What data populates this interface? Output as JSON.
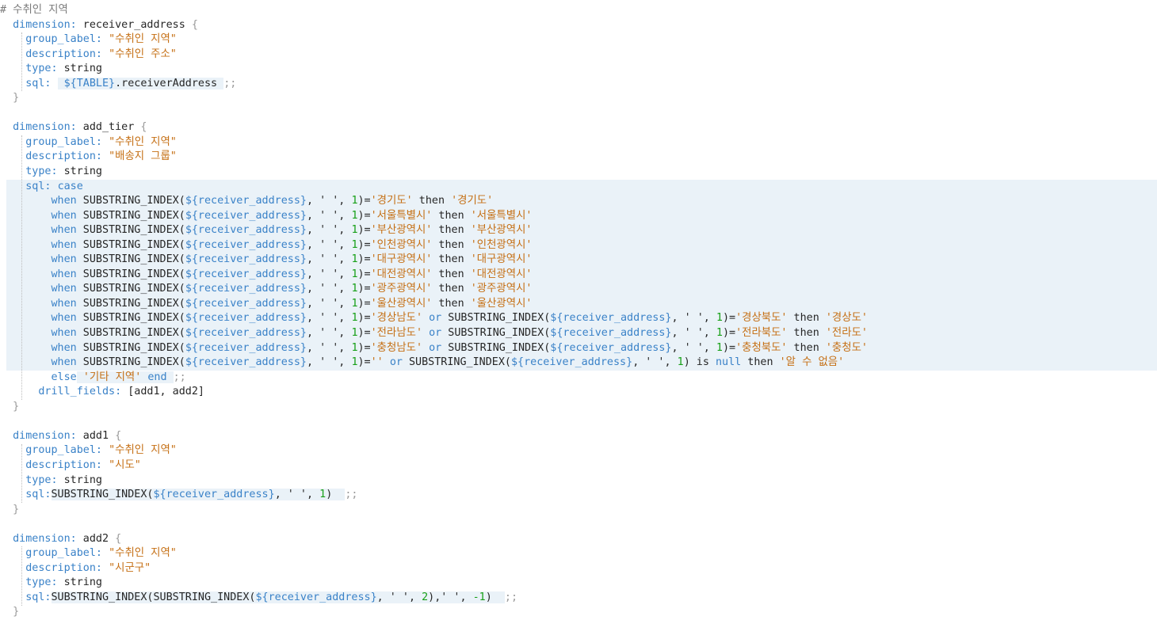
{
  "editor": {
    "lines": [
      [
        {
          "t": "# 수취인 지역",
          "c": "c"
        }
      ],
      [
        {
          "t": "  "
        },
        {
          "t": "dimension:",
          "c": "k"
        },
        {
          "t": " receiver_address "
        },
        {
          "t": "{",
          "c": "g"
        }
      ],
      [
        {
          "t": "    "
        },
        {
          "t": "group_label:",
          "c": "k"
        },
        {
          "t": " "
        },
        {
          "t": "\"수취인 지역\"",
          "c": "s"
        }
      ],
      [
        {
          "t": "    "
        },
        {
          "t": "description:",
          "c": "k"
        },
        {
          "t": " "
        },
        {
          "t": "\"수취인 주소\"",
          "c": "s"
        }
      ],
      [
        {
          "t": "    "
        },
        {
          "t": "type:",
          "c": "k"
        },
        {
          "t": " string"
        }
      ],
      [
        {
          "t": "    "
        },
        {
          "t": "sql:",
          "c": "k"
        },
        {
          "t": " "
        },
        {
          "t": " ${TABLE}",
          "c": "v",
          "bg": true
        },
        {
          "t": ".receiverAddress ",
          "bg": true
        },
        {
          "t": ";;",
          "c": "g"
        }
      ],
      [
        {
          "t": "  "
        },
        {
          "t": "}",
          "c": "g"
        }
      ],
      [
        {
          "t": ""
        }
      ],
      [
        {
          "t": "  "
        },
        {
          "t": "dimension:",
          "c": "k"
        },
        {
          "t": " add_tier "
        },
        {
          "t": "{",
          "c": "g"
        }
      ],
      [
        {
          "t": "    "
        },
        {
          "t": "group_label:",
          "c": "k"
        },
        {
          "t": " "
        },
        {
          "t": "\"수취인 지역\"",
          "c": "s"
        }
      ],
      [
        {
          "t": "    "
        },
        {
          "t": "description:",
          "c": "k"
        },
        {
          "t": " "
        },
        {
          "t": "\"배송지 그룹\"",
          "c": "s"
        }
      ],
      [
        {
          "t": "    "
        },
        {
          "t": "type:",
          "c": "k"
        },
        {
          "t": " string"
        }
      ],
      {
        "hl": true,
        "s": [
          {
            "t": "    "
          },
          {
            "t": "sql:",
            "c": "k"
          },
          {
            "t": " "
          },
          {
            "t": "case",
            "c": "k"
          }
        ]
      },
      {
        "hl": true,
        "s": [
          {
            "t": "        "
          },
          {
            "t": "when",
            "c": "k"
          },
          {
            "t": " SUBSTRING_INDEX("
          },
          {
            "t": "${receiver_address}",
            "c": "v"
          },
          {
            "t": ", ' ', "
          },
          {
            "t": "1",
            "c": "n"
          },
          {
            "t": ")="
          },
          {
            "t": "'경기도'",
            "c": "s"
          },
          {
            "t": " then "
          },
          {
            "t": "'경기도'",
            "c": "s"
          }
        ]
      },
      {
        "hl": true,
        "s": [
          {
            "t": "        "
          },
          {
            "t": "when",
            "c": "k"
          },
          {
            "t": " SUBSTRING_INDEX("
          },
          {
            "t": "${receiver_address}",
            "c": "v"
          },
          {
            "t": ", ' ', "
          },
          {
            "t": "1",
            "c": "n"
          },
          {
            "t": ")="
          },
          {
            "t": "'서울특별시'",
            "c": "s"
          },
          {
            "t": " then "
          },
          {
            "t": "'서울특별시'",
            "c": "s"
          }
        ]
      },
      {
        "hl": true,
        "s": [
          {
            "t": "        "
          },
          {
            "t": "when",
            "c": "k"
          },
          {
            "t": " SUBSTRING_INDEX("
          },
          {
            "t": "${receiver_address}",
            "c": "v"
          },
          {
            "t": ", ' ', "
          },
          {
            "t": "1",
            "c": "n"
          },
          {
            "t": ")="
          },
          {
            "t": "'부산광역시'",
            "c": "s"
          },
          {
            "t": " then "
          },
          {
            "t": "'부산광역시'",
            "c": "s"
          }
        ]
      },
      {
        "hl": true,
        "s": [
          {
            "t": "        "
          },
          {
            "t": "when",
            "c": "k"
          },
          {
            "t": " SUBSTRING_INDEX("
          },
          {
            "t": "${receiver_address}",
            "c": "v"
          },
          {
            "t": ", ' ', "
          },
          {
            "t": "1",
            "c": "n"
          },
          {
            "t": ")="
          },
          {
            "t": "'인천광역시'",
            "c": "s"
          },
          {
            "t": " then "
          },
          {
            "t": "'인천광역시'",
            "c": "s"
          }
        ]
      },
      {
        "hl": true,
        "s": [
          {
            "t": "        "
          },
          {
            "t": "when",
            "c": "k"
          },
          {
            "t": " SUBSTRING_INDEX("
          },
          {
            "t": "${receiver_address}",
            "c": "v"
          },
          {
            "t": ", ' ', "
          },
          {
            "t": "1",
            "c": "n"
          },
          {
            "t": ")="
          },
          {
            "t": "'대구광역시'",
            "c": "s"
          },
          {
            "t": " then "
          },
          {
            "t": "'대구광역시'",
            "c": "s"
          }
        ]
      },
      {
        "hl": true,
        "s": [
          {
            "t": "        "
          },
          {
            "t": "when",
            "c": "k"
          },
          {
            "t": " SUBSTRING_INDEX("
          },
          {
            "t": "${receiver_address}",
            "c": "v"
          },
          {
            "t": ", ' ', "
          },
          {
            "t": "1",
            "c": "n"
          },
          {
            "t": ")="
          },
          {
            "t": "'대전광역시'",
            "c": "s"
          },
          {
            "t": " then "
          },
          {
            "t": "'대전광역시'",
            "c": "s"
          }
        ]
      },
      {
        "hl": true,
        "s": [
          {
            "t": "        "
          },
          {
            "t": "when",
            "c": "k"
          },
          {
            "t": " SUBSTRING_INDEX("
          },
          {
            "t": "${receiver_address}",
            "c": "v"
          },
          {
            "t": ", ' ', "
          },
          {
            "t": "1",
            "c": "n"
          },
          {
            "t": ")="
          },
          {
            "t": "'광주광역시'",
            "c": "s"
          },
          {
            "t": " then "
          },
          {
            "t": "'광주광역시'",
            "c": "s"
          }
        ]
      },
      {
        "hl": true,
        "s": [
          {
            "t": "        "
          },
          {
            "t": "when",
            "c": "k"
          },
          {
            "t": " SUBSTRING_INDEX("
          },
          {
            "t": "${receiver_address}",
            "c": "v"
          },
          {
            "t": ", ' ', "
          },
          {
            "t": "1",
            "c": "n"
          },
          {
            "t": ")="
          },
          {
            "t": "'울산광역시'",
            "c": "s"
          },
          {
            "t": " then "
          },
          {
            "t": "'울산광역시'",
            "c": "s"
          }
        ]
      },
      {
        "hl": true,
        "s": [
          {
            "t": "        "
          },
          {
            "t": "when",
            "c": "k"
          },
          {
            "t": " SUBSTRING_INDEX("
          },
          {
            "t": "${receiver_address}",
            "c": "v"
          },
          {
            "t": ", ' ', "
          },
          {
            "t": "1",
            "c": "n"
          },
          {
            "t": ")="
          },
          {
            "t": "'경상남도'",
            "c": "s"
          },
          {
            "t": " "
          },
          {
            "t": "or",
            "c": "k"
          },
          {
            "t": " SUBSTRING_INDEX("
          },
          {
            "t": "${receiver_address}",
            "c": "v"
          },
          {
            "t": ", ' ', "
          },
          {
            "t": "1",
            "c": "n"
          },
          {
            "t": ")="
          },
          {
            "t": "'경상북도'",
            "c": "s"
          },
          {
            "t": " then "
          },
          {
            "t": "'경상도'",
            "c": "s"
          }
        ]
      },
      {
        "hl": true,
        "s": [
          {
            "t": "        "
          },
          {
            "t": "when",
            "c": "k"
          },
          {
            "t": " SUBSTRING_INDEX("
          },
          {
            "t": "${receiver_address}",
            "c": "v"
          },
          {
            "t": ", ' ', "
          },
          {
            "t": "1",
            "c": "n"
          },
          {
            "t": ")="
          },
          {
            "t": "'전라남도'",
            "c": "s"
          },
          {
            "t": " "
          },
          {
            "t": "or",
            "c": "k"
          },
          {
            "t": " SUBSTRING_INDEX("
          },
          {
            "t": "${receiver_address}",
            "c": "v"
          },
          {
            "t": ", ' ', "
          },
          {
            "t": "1",
            "c": "n"
          },
          {
            "t": ")="
          },
          {
            "t": "'전라북도'",
            "c": "s"
          },
          {
            "t": " then "
          },
          {
            "t": "'전라도'",
            "c": "s"
          }
        ]
      },
      {
        "hl": true,
        "s": [
          {
            "t": "        "
          },
          {
            "t": "when",
            "c": "k"
          },
          {
            "t": " SUBSTRING_INDEX("
          },
          {
            "t": "${receiver_address}",
            "c": "v"
          },
          {
            "t": ", ' ', "
          },
          {
            "t": "1",
            "c": "n"
          },
          {
            "t": ")="
          },
          {
            "t": "'충청남도'",
            "c": "s"
          },
          {
            "t": " "
          },
          {
            "t": "or",
            "c": "k"
          },
          {
            "t": " SUBSTRING_INDEX("
          },
          {
            "t": "${receiver_address}",
            "c": "v"
          },
          {
            "t": ", ' ', "
          },
          {
            "t": "1",
            "c": "n"
          },
          {
            "t": ")="
          },
          {
            "t": "'충청북도'",
            "c": "s"
          },
          {
            "t": " then "
          },
          {
            "t": "'충청도'",
            "c": "s"
          }
        ]
      },
      {
        "hl": true,
        "s": [
          {
            "t": "        "
          },
          {
            "t": "when",
            "c": "k"
          },
          {
            "t": " SUBSTRING_INDEX("
          },
          {
            "t": "${receiver_address}",
            "c": "v"
          },
          {
            "t": ", ' ', "
          },
          {
            "t": "1",
            "c": "n"
          },
          {
            "t": ")="
          },
          {
            "t": "''",
            "c": "s"
          },
          {
            "t": " "
          },
          {
            "t": "or",
            "c": "k"
          },
          {
            "t": " SUBSTRING_INDEX("
          },
          {
            "t": "${receiver_address}",
            "c": "v"
          },
          {
            "t": ", ' ', "
          },
          {
            "t": "1",
            "c": "n"
          },
          {
            "t": ") is "
          },
          {
            "t": "null",
            "c": "k"
          },
          {
            "t": " then "
          },
          {
            "t": "'알 수 없음'",
            "c": "s"
          }
        ]
      },
      [
        {
          "t": "        "
        },
        {
          "t": "else",
          "c": "k"
        },
        {
          "t": " ",
          "bg": true
        },
        {
          "t": "'기타 지역'",
          "c": "s",
          "bg": true
        },
        {
          "t": " ",
          "bg": true
        },
        {
          "t": "end",
          "c": "k",
          "bg": true
        },
        {
          "t": " ",
          "bg": true
        },
        {
          "t": ";;",
          "c": "g"
        }
      ],
      [
        {
          "t": "      "
        },
        {
          "t": "drill_fields:",
          "c": "k"
        },
        {
          "t": " [add1, add2]"
        }
      ],
      [
        {
          "t": "  "
        },
        {
          "t": "}",
          "c": "g"
        }
      ],
      [
        {
          "t": ""
        }
      ],
      [
        {
          "t": "  "
        },
        {
          "t": "dimension:",
          "c": "k"
        },
        {
          "t": " add1 "
        },
        {
          "t": "{",
          "c": "g"
        }
      ],
      [
        {
          "t": "    "
        },
        {
          "t": "group_label:",
          "c": "k"
        },
        {
          "t": " "
        },
        {
          "t": "\"수취인 지역\"",
          "c": "s"
        }
      ],
      [
        {
          "t": "    "
        },
        {
          "t": "description:",
          "c": "k"
        },
        {
          "t": " "
        },
        {
          "t": "\"시도\"",
          "c": "s"
        }
      ],
      [
        {
          "t": "    "
        },
        {
          "t": "type:",
          "c": "k"
        },
        {
          "t": " string"
        }
      ],
      [
        {
          "t": "    "
        },
        {
          "t": "sql:",
          "c": "k"
        },
        {
          "t": "SUBSTRING_INDEX(",
          "bg": true
        },
        {
          "t": "${receiver_address}",
          "c": "v",
          "bg": true
        },
        {
          "t": ", ' ', ",
          "bg": true
        },
        {
          "t": "1",
          "c": "n",
          "bg": true
        },
        {
          "t": ")  ",
          "bg": true
        },
        {
          "t": ";;",
          "c": "g"
        }
      ],
      [
        {
          "t": "  "
        },
        {
          "t": "}",
          "c": "g"
        }
      ],
      [
        {
          "t": ""
        }
      ],
      [
        {
          "t": "  "
        },
        {
          "t": "dimension:",
          "c": "k"
        },
        {
          "t": " add2 "
        },
        {
          "t": "{",
          "c": "g"
        }
      ],
      [
        {
          "t": "    "
        },
        {
          "t": "group_label:",
          "c": "k"
        },
        {
          "t": " "
        },
        {
          "t": "\"수취인 지역\"",
          "c": "s"
        }
      ],
      [
        {
          "t": "    "
        },
        {
          "t": "description:",
          "c": "k"
        },
        {
          "t": " "
        },
        {
          "t": "\"시군구\"",
          "c": "s"
        }
      ],
      [
        {
          "t": "    "
        },
        {
          "t": "type:",
          "c": "k"
        },
        {
          "t": " string"
        }
      ],
      [
        {
          "t": "    "
        },
        {
          "t": "sql:",
          "c": "k"
        },
        {
          "t": "SUBSTRING_INDEX(SUBSTRING_INDEX(",
          "bg": true
        },
        {
          "t": "${receiver_address}",
          "c": "v",
          "bg": true
        },
        {
          "t": ", ' ', ",
          "bg": true
        },
        {
          "t": "2",
          "c": "n",
          "bg": true
        },
        {
          "t": "),' ', ",
          "bg": true
        },
        {
          "t": "-1",
          "c": "n",
          "bg": true
        },
        {
          "t": ")  ",
          "bg": true
        },
        {
          "t": ";;",
          "c": "g"
        }
      ],
      [
        {
          "t": "  "
        },
        {
          "t": "}",
          "c": "g"
        }
      ]
    ]
  }
}
